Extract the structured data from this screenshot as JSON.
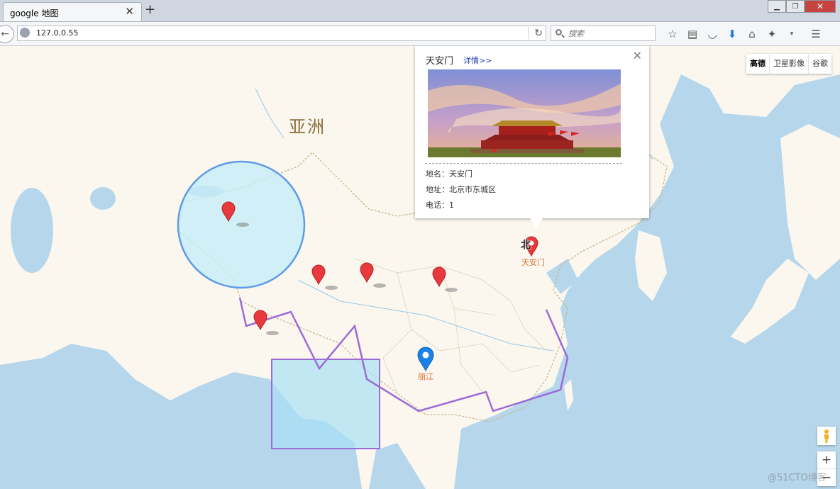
{
  "browser": {
    "tab_title": "google 地图",
    "tab_close": "✕",
    "new_tab": "+",
    "url": "127.0.0.55",
    "search_placeholder": "搜索",
    "window_buttons": [
      "▁",
      "❐",
      "✕"
    ]
  },
  "map": {
    "continent_label": "亚洲",
    "map_types": [
      "高德",
      "卫星影像",
      "谷歌"
    ],
    "labels": {
      "tiananmen": "天安门",
      "lijiang": "丽江",
      "beijing": "北"
    },
    "zoom": {
      "in": "+",
      "out": "−"
    }
  },
  "infowindow": {
    "title": "天安门",
    "detail_link": "详情>>",
    "close": "✕",
    "name_line": "地名：天安门",
    "address_line": "地址：北京市东城区",
    "phone_line": "电话：1"
  },
  "watermark": "@51CTO博客",
  "colors": {
    "sea": "#b6d6ec",
    "land": "#fbf7ee",
    "marker_red": "#e8393d",
    "marker_blue": "#1a82e6",
    "circle_fill": "#c6ecf7",
    "circle_stroke": "#5e9be6",
    "polyline": "#9b6bd6",
    "rect_fill": "#a8e0f5",
    "rect_stroke": "#9b6bd6"
  }
}
